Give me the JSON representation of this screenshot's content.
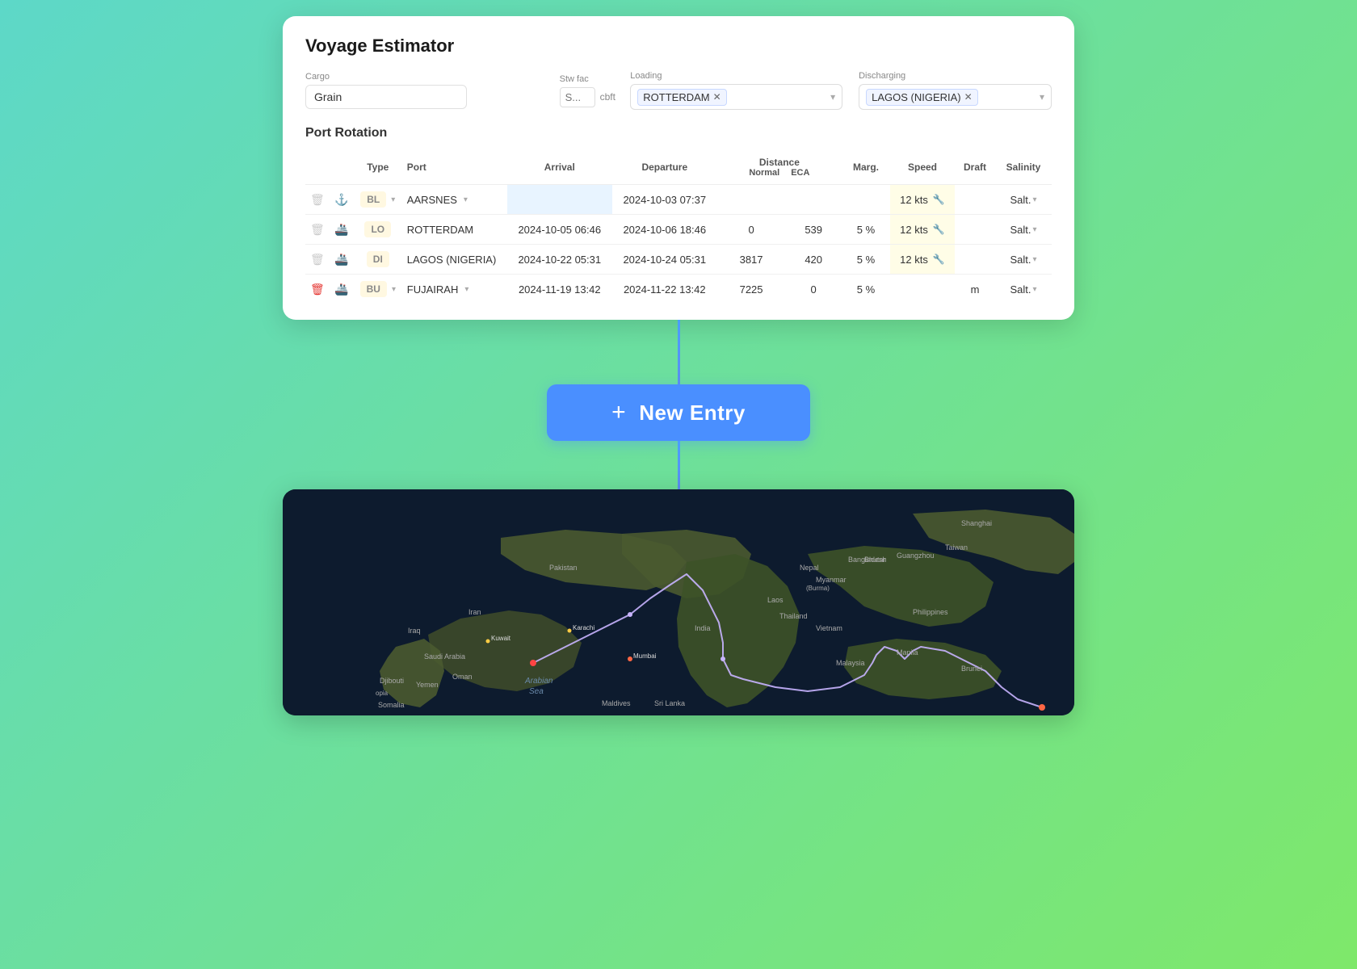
{
  "app": {
    "title": "Voyage Estimator"
  },
  "cargo": {
    "label": "Cargo",
    "value": "Grain",
    "stw_label": "Stw fac",
    "stw_value": "S...",
    "stw_unit": "cbft",
    "loading_label": "Loading",
    "loading_tags": [
      "ROTTERDAM"
    ],
    "discharging_label": "Discharging",
    "discharging_tags": [
      "LAGOS (NIGERIA)"
    ]
  },
  "port_rotation": {
    "title": "Port Rotation",
    "columns": {
      "type": "Type",
      "port": "Port",
      "arrival": "Arrival",
      "departure": "Departure",
      "distance": "Distance",
      "dist_normal": "Normal",
      "dist_eca": "ECA",
      "marg": "Marg.",
      "speed": "Speed",
      "draft": "Draft",
      "salinity": "Salinity"
    },
    "rows": [
      {
        "id": 1,
        "delete_active": false,
        "type": "BL",
        "port": "AARSNES",
        "arrival": "",
        "departure": "2024-10-03 07:37",
        "dist_normal": "",
        "dist_eca": "",
        "marg": "",
        "speed": "12 kts",
        "draft": "",
        "salinity": "Salt."
      },
      {
        "id": 2,
        "delete_active": false,
        "type": "LO",
        "port": "ROTTERDAM",
        "arrival": "2024-10-05 06:46",
        "departure": "2024-10-06 18:46",
        "dist_normal": "0",
        "dist_eca": "539",
        "marg": "5 %",
        "speed": "12 kts",
        "draft": "",
        "salinity": "Salt."
      },
      {
        "id": 3,
        "delete_active": false,
        "type": "DI",
        "port": "LAGOS (NIGERIA)",
        "arrival": "2024-10-22 05:31",
        "departure": "2024-10-24 05:31",
        "dist_normal": "3817",
        "dist_eca": "420",
        "marg": "5 %",
        "speed": "12 kts",
        "draft": "",
        "salinity": "Salt."
      },
      {
        "id": 4,
        "delete_active": true,
        "type": "BU",
        "port": "FUJAIRAH",
        "arrival": "2024-11-19 13:42",
        "departure": "2024-11-22 13:42",
        "dist_normal": "7225",
        "dist_eca": "0",
        "marg": "5 %",
        "speed": "",
        "draft": "m",
        "salinity": "Salt."
      }
    ]
  },
  "new_entry": {
    "label": "New Entry",
    "plus": "+"
  },
  "map": {
    "route_color": "#c8b4ff"
  }
}
